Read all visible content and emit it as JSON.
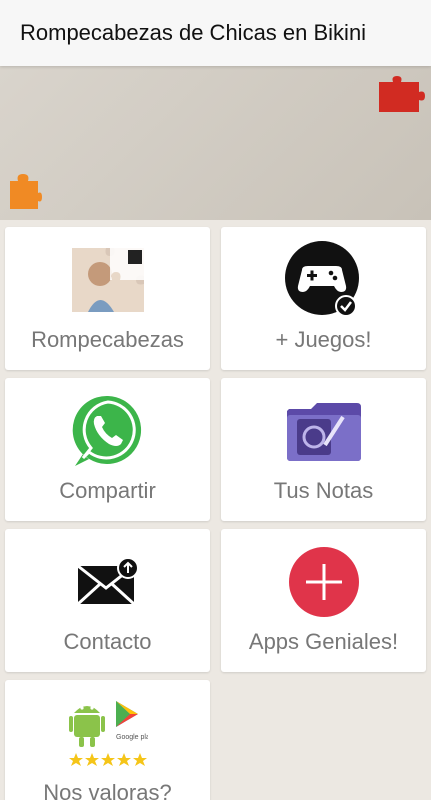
{
  "appbar": {
    "title": "Rompecabezas de Chicas en Bikini"
  },
  "banner": {
    "placeholder": ""
  },
  "tiles": [
    {
      "label": "Rompecabezas",
      "icon": "puzzle-photo-icon"
    },
    {
      "label": "+ Juegos!",
      "icon": "gamepad-icon"
    },
    {
      "label": "Compartir",
      "icon": "whatsapp-icon"
    },
    {
      "label": "Tus Notas",
      "icon": "notes-folder-icon"
    },
    {
      "label": "Contacto",
      "icon": "mail-icon"
    },
    {
      "label": "Apps Geniales!",
      "icon": "plus-circle-icon"
    },
    {
      "label": "Nos valoras?",
      "icon": "google-play-rating-icon"
    }
  ],
  "colors": {
    "appbar_bg": "#f7f7f7",
    "page_bg": "#ece8e2",
    "tile_bg": "#ffffff",
    "label": "#777777",
    "plus_red": "#e0344a",
    "whatsapp_green": "#3cb54a",
    "star_yellow": "#f5c518",
    "android_green": "#8bc34a"
  }
}
